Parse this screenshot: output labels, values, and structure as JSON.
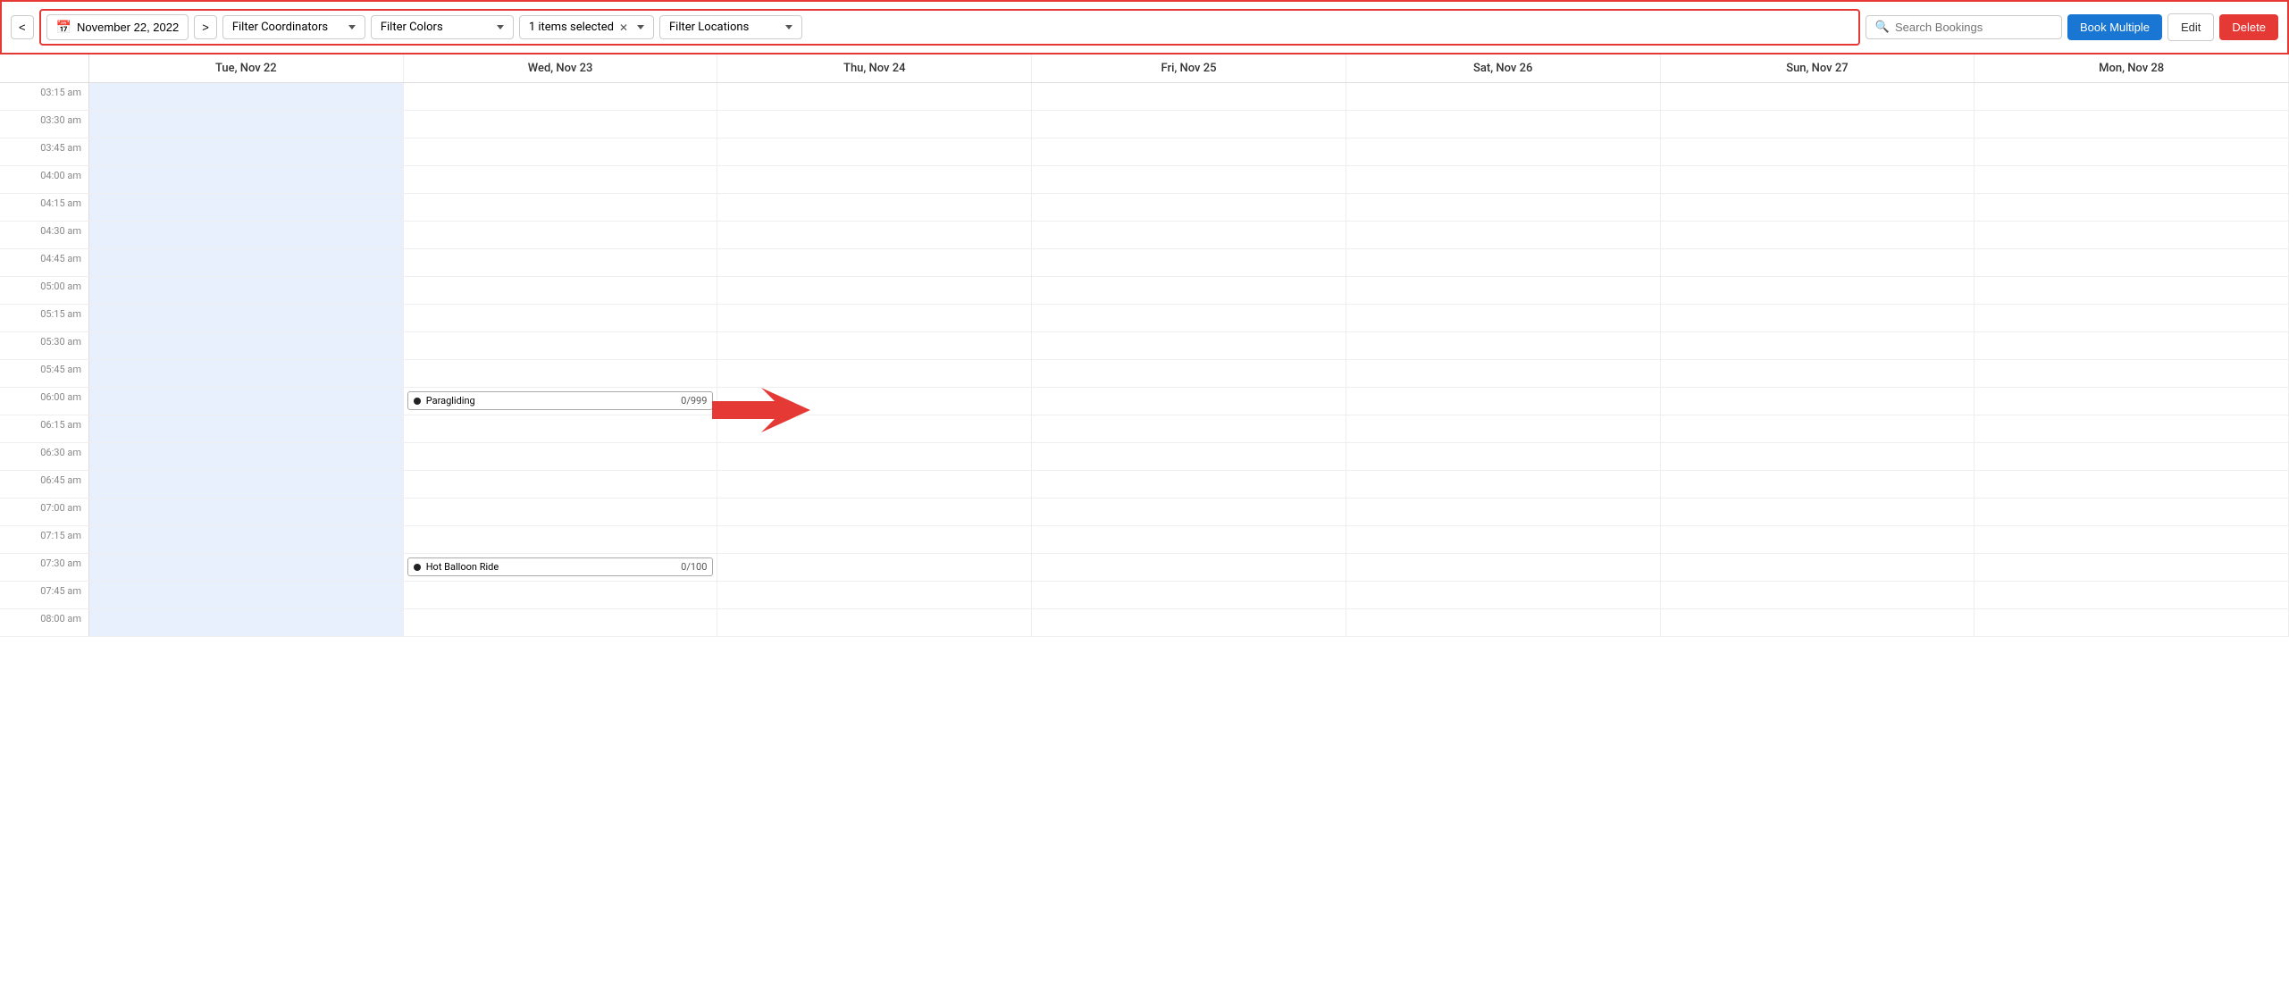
{
  "toolbar": {
    "date_label": "November 22, 2022",
    "prev_label": "<",
    "next_label": ">",
    "filter_coordinators_placeholder": "Filter Coordinators",
    "filter_colors_placeholder": "Filter Colors",
    "items_selected_label": "1 items selected",
    "filter_locations_placeholder": "Filter Locations",
    "search_placeholder": "Search Bookings",
    "book_multiple_label": "Book Multiple",
    "edit_label": "Edit",
    "delete_label": "Delete"
  },
  "calendar": {
    "headers": [
      "",
      "Tue, Nov 22",
      "Wed, Nov 23",
      "Thu, Nov 24",
      "Fri, Nov 25",
      "Sat, Nov 26",
      "Sun, Nov 27",
      "Mon, Nov 28"
    ],
    "time_slots": [
      "03:15 am",
      "03:30 am",
      "03:45 am",
      "04:00 am",
      "04:15 am",
      "04:30 am",
      "04:45 am",
      "05:00 am",
      "05:15 am",
      "05:30 am",
      "05:45 am",
      "06:00 am",
      "06:15 am",
      "06:30 am",
      "06:45 am",
      "07:00 am",
      "07:15 am",
      "07:30 am",
      "07:45 am",
      "08:00 am"
    ],
    "events": [
      {
        "time": "06:00 am",
        "day_index": 2,
        "name": "Paragliding",
        "count": "0/999",
        "has_arrow": true
      },
      {
        "time": "07:30 am",
        "day_index": 2,
        "name": "Hot Balloon Ride",
        "count": "0/100",
        "has_arrow": false
      }
    ]
  }
}
